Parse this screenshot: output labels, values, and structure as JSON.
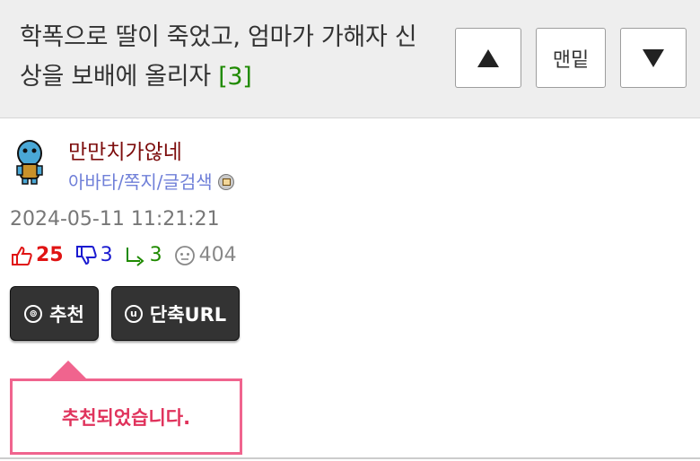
{
  "header": {
    "title": "학폭으로 딸이 죽었고, 엄마가 가해자 신상을 보배에 올리자",
    "comment_count": "[3]",
    "bottom_label": "맨밑"
  },
  "author": {
    "nickname": "만만치가않네",
    "links": "아바타/쪽지/글검색"
  },
  "post": {
    "date": "2024-05-11 11:21:21",
    "likes": "25",
    "dislikes": "3",
    "replies": "3",
    "views": "404"
  },
  "buttons": {
    "recommend_label": "추천",
    "recommend_icon_text": "⊚",
    "short_url_label": "단축URL",
    "short_url_icon_text": "u"
  },
  "toast": {
    "message": "추천되었습니다."
  },
  "colors": {
    "accent_green": "#1f8a00",
    "author_red": "#7d0d0d",
    "like_red": "#e01414",
    "dislike_blue": "#1a1ad0",
    "toast_pink": "#f0648e"
  }
}
